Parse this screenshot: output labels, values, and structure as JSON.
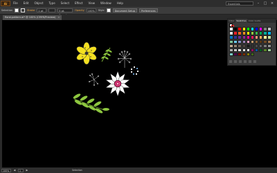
{
  "app": {
    "logo": "Ai",
    "menu": [
      "File",
      "Edit",
      "Object",
      "Type",
      "Select",
      "Effect",
      "View",
      "Window",
      "Help"
    ],
    "workspace": "Essentials"
  },
  "control_bar": {
    "selection_label": "Selection",
    "stroke_label": "Stroke",
    "stroke_weight": "1 pt",
    "brush_label": "5 pt. Round",
    "opacity_label": "Opacity",
    "opacity_value": "100%",
    "style_label": "Style",
    "document_setup": "Document Setup",
    "preferences": "Preferences"
  },
  "document_tab": {
    "title": "floral-pattern.ai* @ 100% (CMYK/Preview)",
    "close": "×"
  },
  "swatches_panel": {
    "tabs": [
      "Color",
      "Swatches",
      "Color Guide"
    ],
    "active_tab": "Swatches",
    "colors": [
      "#ffffff",
      "#000000",
      "#ff0000",
      "#ffff00",
      "#00ff00",
      "#00ffff",
      "#0000ff",
      "#ff00ff",
      "#808080",
      "#c0c0c0",
      "#e0e0e0",
      "#ed1c24",
      "#f26522",
      "#f7941d",
      "#fff200",
      "#8dc63f",
      "#39b54a",
      "#00a651",
      "#00a99d",
      "#00aeef",
      "#0072bc",
      "#2e3192",
      "#662d91",
      "#92278f",
      "#ec008c",
      "#ed145b",
      "#f69679",
      "#fbaf5d",
      "#fff799",
      "#c4df9b",
      "#82ca9c",
      "#6dcff6",
      "#8493ca",
      "#a186be",
      "#f49ac1",
      "#c69c6d",
      "#8c6239",
      "#603913",
      "#754c24",
      "#a67c52",
      "#c7b299",
      "#998675",
      "#736357",
      "#534741",
      "#1a1a1a",
      "#333333",
      "#4d4d4d",
      "#666666",
      "#808080",
      "#999999",
      "#b3b3b3",
      "#cccccc",
      "#e6e6e6",
      "#f2f2f2",
      "#ffffff",
      "#9e005d",
      "#0054a6",
      "#005e20",
      "#598527",
      "#a3d39c",
      "#7accc8",
      "#4b0049",
      "#790000",
      "#7b2e00",
      "#827b00",
      "#406618"
    ]
  },
  "status_bar": {
    "zoom": "100%",
    "artboard": "1",
    "tool": "Selection",
    "prev": "◀",
    "next": "▶"
  },
  "colors": {
    "petal_yellow": "#f4e021",
    "leaf_green": "#8dc63f",
    "flower_white": "#ffffff",
    "flower_center": "#c2185b"
  }
}
